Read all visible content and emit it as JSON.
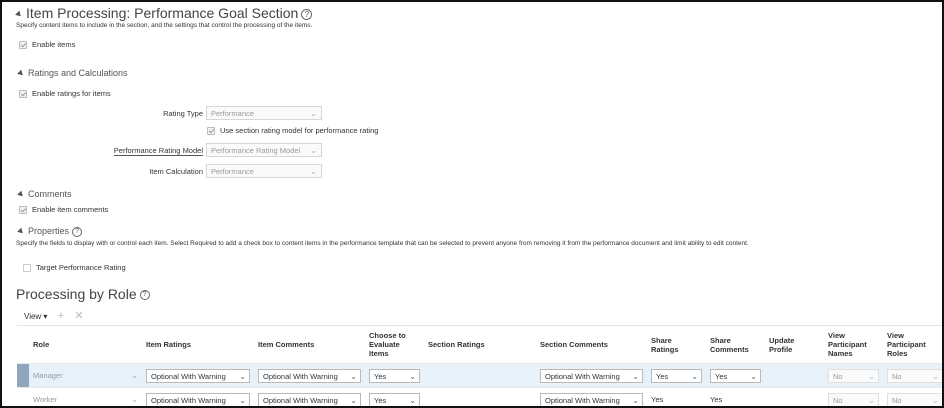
{
  "item_processing": {
    "title": "Item Processing: Performance Goal Section",
    "description": "Specify content items to include in the section, and the settings that control the processing of the items.",
    "enable_items": "Enable items"
  },
  "ratings": {
    "heading": "Ratings and Calculations",
    "enable_ratings": "Enable ratings for items",
    "rating_type_label": "Rating Type",
    "rating_type_value": "Performance",
    "use_section_model": "Use section rating model for performance rating",
    "perf_model_label": "Performance Rating Model",
    "perf_model_value": "Performance Rating Model",
    "item_calc_label": "Item Calculation",
    "item_calc_value": "Performance"
  },
  "comments": {
    "heading": "Comments",
    "enable_comments": "Enable item comments"
  },
  "properties": {
    "heading": "Properties",
    "description": "Specify the fields to display with or control each item. Select Required to add a check box to content items in the performance template that can be selected to prevent anyone from removing it from the performance document and limit ability to edit content.",
    "target_rating": "Target Performance Rating"
  },
  "processing": {
    "title": "Processing by Role",
    "view_menu": "View",
    "add_icon": "plus-icon",
    "delete_icon": "close-icon",
    "columns": {
      "role": "Role",
      "item_ratings": "Item Ratings",
      "item_comments": "Item Comments",
      "choose_evaluate": [
        "Choose to",
        "Evaluate",
        "Items"
      ],
      "section_ratings": "Section Ratings",
      "section_comments": "Section Comments",
      "share_ratings": [
        "Share",
        "Ratings"
      ],
      "share_comments": [
        "Share",
        "Comments"
      ],
      "update_profile": [
        "Update",
        "Profile"
      ],
      "view_participant_names": [
        "View",
        "Participant",
        "Names"
      ],
      "view_participant_roles": [
        "View",
        "Participant",
        "Roles"
      ]
    },
    "rows": [
      {
        "role": "Manager",
        "item_ratings": "Optional With Warning",
        "item_comments": "Optional With Warning",
        "choose_evaluate": "Yes",
        "section_comments": "Optional With Warning",
        "share_ratings": "Yes",
        "share_comments": "Yes",
        "view_names": "No",
        "view_roles": "No"
      },
      {
        "role": "Worker",
        "item_ratings": "Optional With Warning",
        "item_comments": "Optional With Warning",
        "choose_evaluate": "Yes",
        "section_comments": "Optional With Warning",
        "share_ratings": "Yes",
        "share_comments": "Yes",
        "view_names": "No",
        "view_roles": "No"
      }
    ]
  },
  "colors": {
    "selected_row": "#e6f1fa",
    "row_marker": "#8ea7bf",
    "border": "#111111"
  }
}
